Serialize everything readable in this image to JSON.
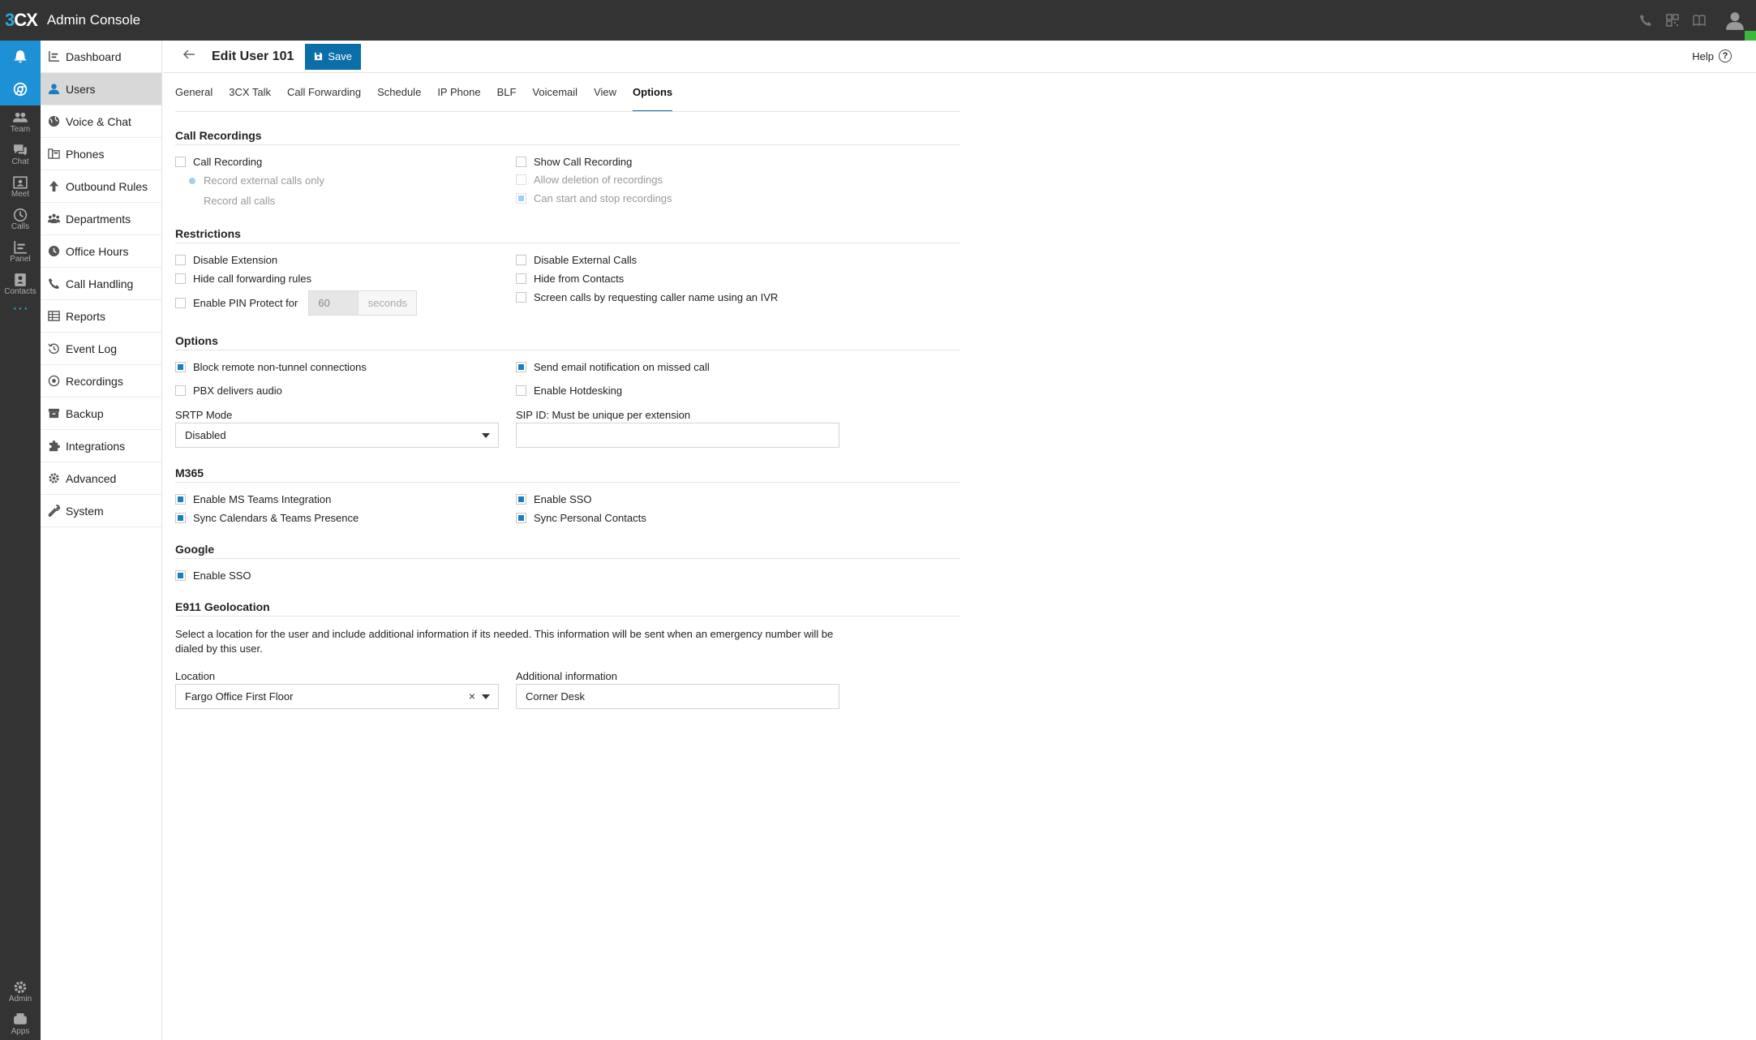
{
  "app": {
    "logo_prefix": "3",
    "logo_suffix": "CX",
    "title": "Admin Console"
  },
  "rail": [
    {
      "label": "",
      "icon": "bell-icon"
    },
    {
      "label": "",
      "icon": "chrome-icon"
    },
    {
      "label": "Team",
      "icon": "team-icon"
    },
    {
      "label": "Chat",
      "icon": "chat-icon"
    },
    {
      "label": "Meet",
      "icon": "meet-icon"
    },
    {
      "label": "Calls",
      "icon": "calls-icon"
    },
    {
      "label": "Panel",
      "icon": "panel-icon"
    },
    {
      "label": "Contacts",
      "icon": "contacts-icon"
    }
  ],
  "rail_more": "···",
  "rail_bottom": [
    {
      "label": "Admin",
      "icon": "gear-icon"
    },
    {
      "label": "Apps",
      "icon": "apps-icon"
    }
  ],
  "sidebar": {
    "items": [
      {
        "label": "Dashboard",
        "icon": "dashboard-icon"
      },
      {
        "label": "Users",
        "icon": "user-icon",
        "active": true
      },
      {
        "label": "Voice & Chat",
        "icon": "globe-icon"
      },
      {
        "label": "Phones",
        "icon": "phones-icon"
      },
      {
        "label": "Outbound Rules",
        "icon": "arrow-up-icon"
      },
      {
        "label": "Departments",
        "icon": "departments-icon"
      },
      {
        "label": "Office Hours",
        "icon": "clock-icon"
      },
      {
        "label": "Call Handling",
        "icon": "phone-icon"
      },
      {
        "label": "Reports",
        "icon": "reports-icon"
      },
      {
        "label": "Event Log",
        "icon": "history-icon"
      },
      {
        "label": "Recordings",
        "icon": "record-icon"
      },
      {
        "label": "Backup",
        "icon": "archive-icon"
      },
      {
        "label": "Integrations",
        "icon": "puzzle-icon"
      },
      {
        "label": "Advanced",
        "icon": "cog-icon"
      },
      {
        "label": "System",
        "icon": "wrench-icon"
      }
    ]
  },
  "header": {
    "title": "Edit User 101",
    "save_label": "Save",
    "help_label": "Help"
  },
  "tabs": [
    "General",
    "3CX Talk",
    "Call Forwarding",
    "Schedule",
    "IP Phone",
    "BLF",
    "Voicemail",
    "View",
    "Options"
  ],
  "active_tab": "Options",
  "call_recordings": {
    "title": "Call Recordings",
    "call_recording": "Call Recording",
    "record_external": "Record external calls only",
    "record_all": "Record all calls",
    "show_call_recording": "Show Call Recording",
    "allow_deletion": "Allow deletion of recordings",
    "can_start_stop": "Can start and stop recordings"
  },
  "restrictions": {
    "title": "Restrictions",
    "disable_extension": "Disable Extension",
    "hide_forwarding": "Hide call forwarding rules",
    "enable_pin": "Enable PIN Protect for",
    "pin_value": "60",
    "pin_unit": "seconds",
    "disable_external": "Disable External Calls",
    "hide_contacts": "Hide from Contacts",
    "screen_calls": "Screen calls by requesting caller name using an IVR"
  },
  "options": {
    "title": "Options",
    "block_remote": "Block remote non-tunnel connections",
    "pbx_audio": "PBX delivers audio",
    "send_email": "Send email notification on missed call",
    "hotdesking": "Enable Hotdesking",
    "srtp_label": "SRTP Mode",
    "srtp_value": "Disabled",
    "sip_label": "SIP ID: Must be unique per extension",
    "sip_value": ""
  },
  "m365": {
    "title": "M365",
    "ms_teams": "Enable MS Teams Integration",
    "sync_calendars": "Sync Calendars & Teams Presence",
    "enable_sso": "Enable SSO",
    "sync_contacts": "Sync Personal Contacts"
  },
  "google": {
    "title": "Google",
    "enable_sso": "Enable SSO"
  },
  "e911": {
    "title": "E911 Geolocation",
    "description": "Select a location for the user and include additional information if its needed. This information will be sent when an emergency number will be dialed by this user.",
    "location_label": "Location",
    "location_value": "Fargo Office First Floor",
    "clear_symbol": "×",
    "additional_label": "Additional information",
    "additional_value": "Corner Desk"
  },
  "colors": {
    "topbar": "#333333",
    "accent": "#1e90d6",
    "save_button": "#0b6ea8",
    "check": "#1a7fc1",
    "status_online": "#3bb83b"
  }
}
